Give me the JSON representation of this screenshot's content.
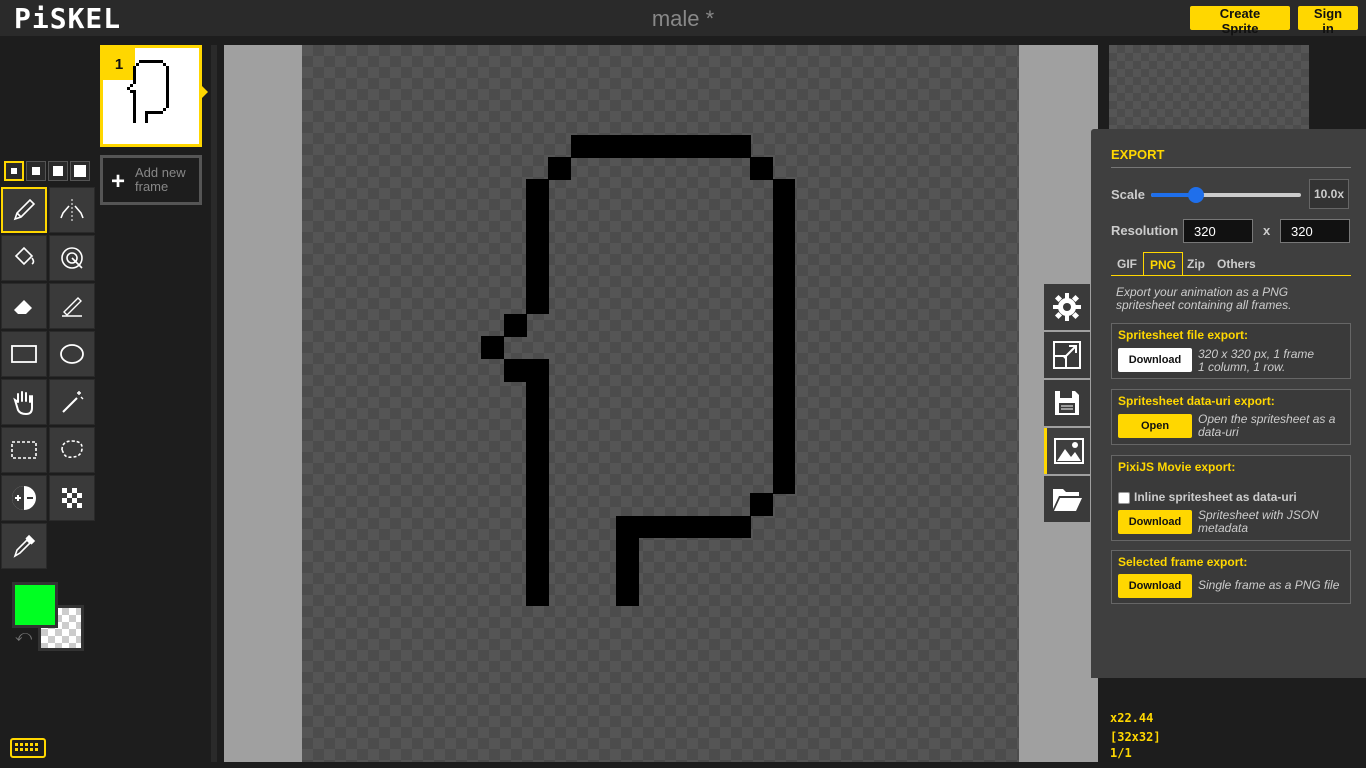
{
  "app": {
    "logo": "PiSKEL",
    "title": "male *"
  },
  "header": {
    "create_sprite": "Create Sprite",
    "sign_in": "Sign in"
  },
  "pen_sizes": {
    "selected": 1,
    "count": 4
  },
  "tools": [
    "pen-tool",
    "vertical-mirror-pen-tool",
    "paint-bucket-tool",
    "paint-all-same-color-tool",
    "eraser-tool",
    "stroke-tool",
    "rectangle-tool",
    "circle-tool",
    "move-tool",
    "magic-wand-tool",
    "rectangle-selection-tool",
    "lasso-selection-tool",
    "lighten-tool",
    "dithering-tool",
    "color-picker-tool"
  ],
  "colors": {
    "primary": "#00ff22",
    "secondary": "transparent",
    "accent": "#ffd700"
  },
  "frames": {
    "items": [
      {
        "number": "1"
      }
    ],
    "add_label_line1": "Add new",
    "add_label_line2": "frame"
  },
  "export": {
    "title": "EXPORT",
    "scale_label": "Scale",
    "scale_value": "10.0x",
    "scale_fraction": 0.3,
    "resolution_label": "Resolution",
    "width": "320",
    "height": "320",
    "x_sep": "x",
    "tabs": [
      "GIF",
      "PNG",
      "Zip",
      "Others"
    ],
    "active_tab": "PNG",
    "description": "Export your animation as a PNG spritesheet containing all frames.",
    "sections": {
      "spritesheet_file": {
        "title": "Spritesheet file export:",
        "button": "Download",
        "desc_line1": "320 x 320 px, 1 frame",
        "desc_line2": "1 column, 1 row."
      },
      "spritesheet_datauri": {
        "title": "Spritesheet data-uri export:",
        "button": "Open",
        "desc": "Open the spritesheet as a data-uri"
      },
      "pixijs": {
        "title": "PixiJS Movie export:",
        "checkbox_label": "Inline spritesheet as data-uri",
        "button": "Download",
        "desc": "Spritesheet with JSON metadata"
      },
      "selected_frame": {
        "title": "Selected frame export:",
        "button": "Download",
        "desc": "Single frame as a PNG file"
      }
    }
  },
  "side_tabs": [
    "settings-icon",
    "resize-icon",
    "save-icon",
    "export-image-icon",
    "import-folder-icon"
  ],
  "status": {
    "zoom": "x22.44",
    "size": "[32x32]",
    "frame": "1/1"
  },
  "sprite": {
    "grid": 32,
    "pixels": [
      [
        12,
        4
      ],
      [
        13,
        4
      ],
      [
        14,
        4
      ],
      [
        15,
        4
      ],
      [
        16,
        4
      ],
      [
        17,
        4
      ],
      [
        18,
        4
      ],
      [
        19,
        4
      ],
      [
        11,
        5
      ],
      [
        20,
        5
      ],
      [
        10,
        6
      ],
      [
        21,
        6
      ],
      [
        10,
        7
      ],
      [
        21,
        7
      ],
      [
        10,
        8
      ],
      [
        21,
        8
      ],
      [
        10,
        9
      ],
      [
        21,
        9
      ],
      [
        10,
        10
      ],
      [
        21,
        10
      ],
      [
        10,
        11
      ],
      [
        21,
        11
      ],
      [
        9,
        12
      ],
      [
        21,
        12
      ],
      [
        8,
        13
      ],
      [
        21,
        13
      ],
      [
        9,
        14
      ],
      [
        10,
        14
      ],
      [
        21,
        14
      ],
      [
        10,
        15
      ],
      [
        21,
        15
      ],
      [
        10,
        16
      ],
      [
        21,
        16
      ],
      [
        10,
        17
      ],
      [
        21,
        17
      ],
      [
        10,
        18
      ],
      [
        21,
        18
      ],
      [
        10,
        19
      ],
      [
        21,
        19
      ],
      [
        10,
        20
      ],
      [
        20,
        20
      ],
      [
        10,
        21
      ],
      [
        14,
        21
      ],
      [
        15,
        21
      ],
      [
        16,
        21
      ],
      [
        17,
        21
      ],
      [
        18,
        21
      ],
      [
        19,
        21
      ],
      [
        10,
        22
      ],
      [
        14,
        22
      ],
      [
        10,
        23
      ],
      [
        14,
        23
      ],
      [
        10,
        24
      ],
      [
        14,
        24
      ]
    ]
  }
}
